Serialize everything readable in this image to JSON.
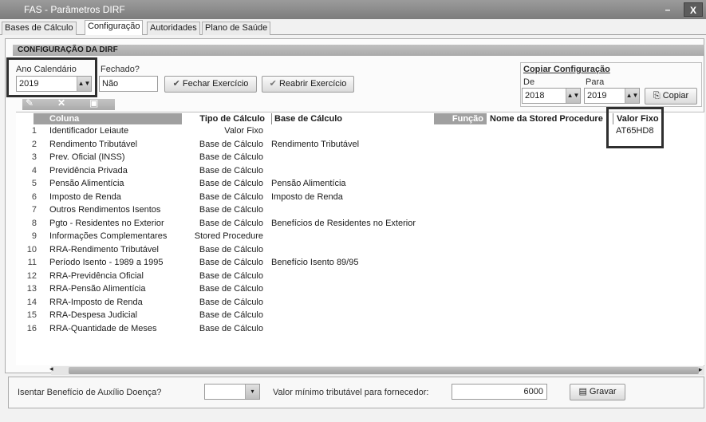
{
  "window": {
    "title": "FAS - Parâmetros DIRF",
    "minimize": "–",
    "close": "X"
  },
  "tabs": [
    {
      "label": "Bases de Cálculo"
    },
    {
      "label": "Configuração"
    },
    {
      "label": "Autoridades"
    },
    {
      "label": "Plano de Saúde"
    }
  ],
  "config": {
    "section_title": "CONFIGURAÇÃO DA DIRF",
    "ano_label": "Ano Calendário",
    "ano_value": "2019",
    "fechado_label": "Fechado?",
    "fechado_value": "Não",
    "fechar_btn": "Fechar Exercício",
    "reabrir_btn": "Reabrir Exercício",
    "copiar_title": "Copiar Configuração",
    "de_label": "De",
    "de_value": "2018",
    "para_label": "Para",
    "para_value": "2019",
    "copiar_btn": "Copiar"
  },
  "grid": {
    "headers": {
      "coluna": "Coluna",
      "tipo": "Tipo de Cálculo",
      "base": "Base de Cálculo",
      "funcao": "Função",
      "stored": "Nome da Stored Procedure",
      "valor_fixo": "Valor Fixo"
    },
    "rows": [
      {
        "num": "1",
        "coluna": "Identificador Leiaute",
        "tipo": "Valor Fixo",
        "base": "",
        "valor_fixo": "AT65HD8"
      },
      {
        "num": "2",
        "coluna": "Rendimento Tributável",
        "tipo": "Base de Cálculo",
        "base": "Rendimento Tributável",
        "valor_fixo": ""
      },
      {
        "num": "3",
        "coluna": "Prev. Oficial (INSS)",
        "tipo": "Base de Cálculo",
        "base": "",
        "valor_fixo": ""
      },
      {
        "num": "4",
        "coluna": "Previdência Privada",
        "tipo": "Base de Cálculo",
        "base": "",
        "valor_fixo": ""
      },
      {
        "num": "5",
        "coluna": "Pensão Alimentícia",
        "tipo": "Base de Cálculo",
        "base": "Pensão Alimentícia",
        "valor_fixo": ""
      },
      {
        "num": "6",
        "coluna": "Imposto de Renda",
        "tipo": "Base de Cálculo",
        "base": "Imposto de Renda",
        "valor_fixo": ""
      },
      {
        "num": "7",
        "coluna": "Outros Rendimentos Isentos",
        "tipo": "Base de Cálculo",
        "base": "",
        "valor_fixo": ""
      },
      {
        "num": "8",
        "coluna": "Pgto - Residentes no Exterior",
        "tipo": "Base de Cálculo",
        "base": "Benefícios de Residentes no Exterior",
        "valor_fixo": ""
      },
      {
        "num": "9",
        "coluna": "Informações Complementares",
        "tipo": "Stored Procedure",
        "base": "",
        "valor_fixo": ""
      },
      {
        "num": "10",
        "coluna": "RRA-Rendimento Tributável",
        "tipo": "Base de Cálculo",
        "base": "",
        "valor_fixo": ""
      },
      {
        "num": "11",
        "coluna": "Período Isento - 1989 a 1995",
        "tipo": "Base de Cálculo",
        "base": "Benefício Isento 89/95",
        "valor_fixo": ""
      },
      {
        "num": "12",
        "coluna": "RRA-Previdência Oficial",
        "tipo": "Base de Cálculo",
        "base": "",
        "valor_fixo": ""
      },
      {
        "num": "13",
        "coluna": "RRA-Pensão Alimentícia",
        "tipo": "Base de Cálculo",
        "base": "",
        "valor_fixo": ""
      },
      {
        "num": "14",
        "coluna": "RRA-Imposto de Renda",
        "tipo": "Base de Cálculo",
        "base": "",
        "valor_fixo": ""
      },
      {
        "num": "15",
        "coluna": "RRA-Despesa Judicial",
        "tipo": "Base de Cálculo",
        "base": "",
        "valor_fixo": ""
      },
      {
        "num": "16",
        "coluna": "RRA-Quantidade de Meses",
        "tipo": "Base de Cálculo",
        "base": "",
        "valor_fixo": ""
      }
    ]
  },
  "footer": {
    "isentar_label": "Isentar Benefício de Auxílio Doença?",
    "isentar_value": "",
    "valor_min_label": "Valor mínimo tributável para fornecedor:",
    "valor_min_value": "6000",
    "gravar_btn": "Gravar"
  }
}
